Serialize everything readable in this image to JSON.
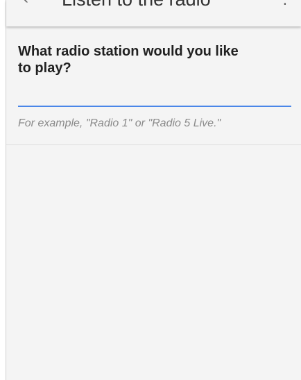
{
  "appbar": {
    "title": "Listen to the radio",
    "back_icon": "arrow-back-icon",
    "more_icon": "more-vert-icon"
  },
  "main": {
    "prompt": "What radio station would you like to play?",
    "input_value": "",
    "hint": "For example, \"Radio 1\" or \"Radio 5 Live.\""
  },
  "colors": {
    "background": "#f4f4f4",
    "accent": "#4a86e8",
    "hint_text": "#8a8a8a",
    "prompt_text": "#212121"
  }
}
